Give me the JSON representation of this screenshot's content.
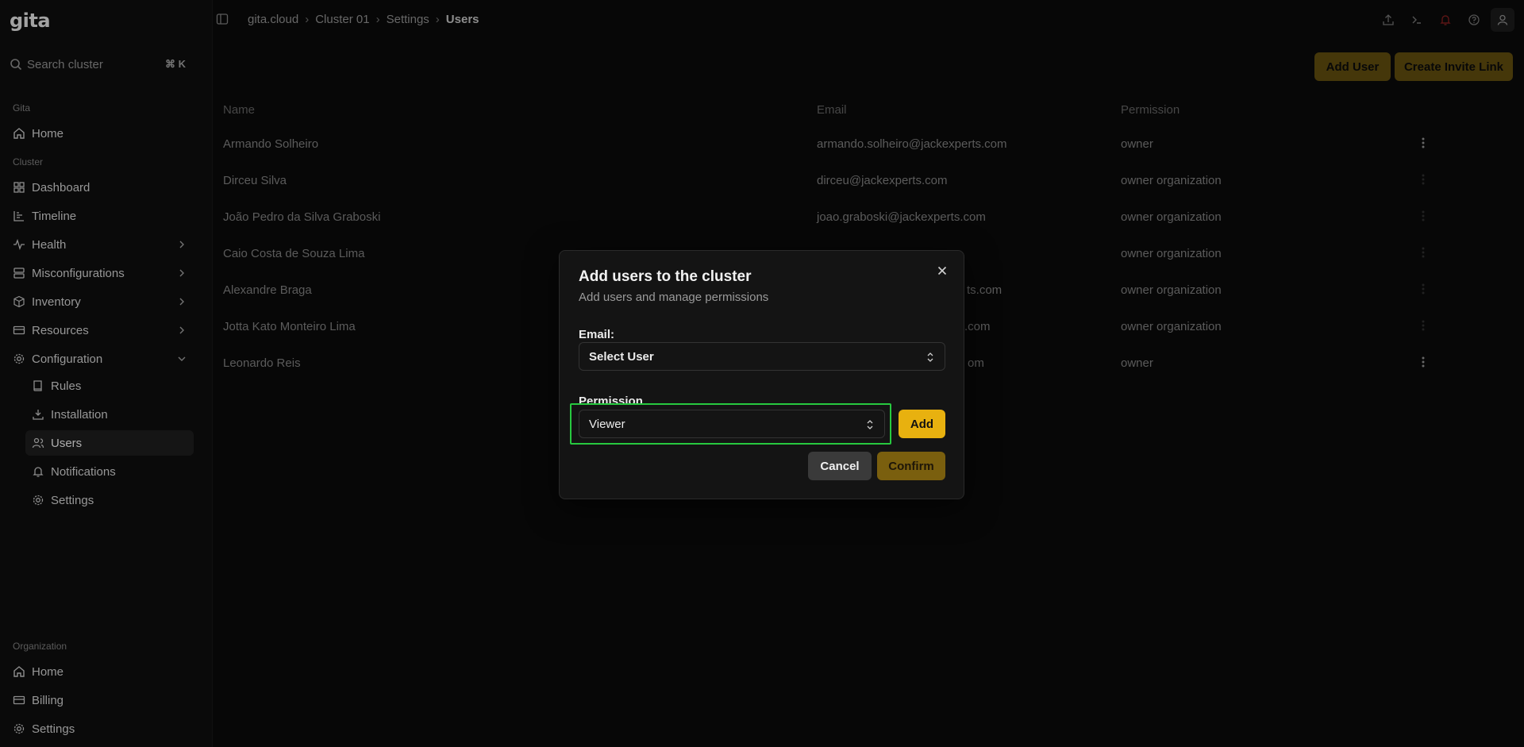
{
  "app": {
    "logo": "gita"
  },
  "sidebar": {
    "search_placeholder": "Search cluster",
    "search_shortcut": "⌘ K",
    "sections": {
      "gita": "Gita",
      "cluster": "Cluster",
      "organization": "Organization"
    },
    "gita_items": [
      {
        "label": "Home",
        "icon": "home-icon"
      }
    ],
    "cluster_items": [
      {
        "label": "Dashboard",
        "icon": "grid-icon"
      },
      {
        "label": "Timeline",
        "icon": "chart-icon"
      },
      {
        "label": "Health",
        "icon": "pulse-icon"
      },
      {
        "label": "Misconfigurations",
        "icon": "server-icon"
      },
      {
        "label": "Inventory",
        "icon": "box-icon"
      },
      {
        "label": "Resources",
        "icon": "card-icon"
      },
      {
        "label": "Configuration",
        "icon": "gear-icon"
      }
    ],
    "config_subitems": [
      {
        "label": "Rules",
        "icon": "book-icon"
      },
      {
        "label": "Installation",
        "icon": "install-icon"
      },
      {
        "label": "Users",
        "icon": "users-icon"
      },
      {
        "label": "Notifications",
        "icon": "bell-icon"
      },
      {
        "label": "Settings",
        "icon": "gear-icon"
      }
    ],
    "org_items": [
      {
        "label": "Home",
        "icon": "home-icon"
      },
      {
        "label": "Billing",
        "icon": "card-icon"
      },
      {
        "label": "Settings",
        "icon": "gear-icon"
      }
    ]
  },
  "breadcrumb": [
    "gita.cloud",
    "Cluster 01",
    "Settings",
    "Users"
  ],
  "header_buttons": {
    "add_user": "Add User",
    "invite": "Create Invite Link"
  },
  "table": {
    "columns": [
      "Name",
      "Email",
      "Permission"
    ],
    "rows": [
      {
        "name": "Armando Solheiro",
        "email": "armando.solheiro@jackexperts.com",
        "permission": "owner"
      },
      {
        "name": "Dirceu Silva",
        "email": "dirceu@jackexperts.com",
        "permission": "owner organization"
      },
      {
        "name": "João Pedro da Silva Graboski",
        "email": "joao.graboski@jackexperts.com",
        "permission": "owner organization"
      },
      {
        "name": "Caio Costa de Souza Lima",
        "email": "",
        "permission": "owner organization"
      },
      {
        "name": "Alexandre Braga",
        "email": "ts.com",
        "permission": "owner organization"
      },
      {
        "name": "Jotta Kato Monteiro Lima",
        "email": ".com",
        "permission": "owner organization"
      },
      {
        "name": "Leonardo Reis",
        "email": "om",
        "permission": "owner"
      }
    ]
  },
  "modal": {
    "title": "Add users to the cluster",
    "subtitle": "Add users and manage permissions",
    "email_label": "Email:",
    "email_value": "Select User",
    "permission_label": "Permission",
    "permission_value": "Viewer",
    "add_label": "Add",
    "cancel_label": "Cancel",
    "confirm_label": "Confirm"
  },
  "colors": {
    "accent": "#e8b10f",
    "focus": "#27c93f",
    "background": "#0a0a0a"
  }
}
